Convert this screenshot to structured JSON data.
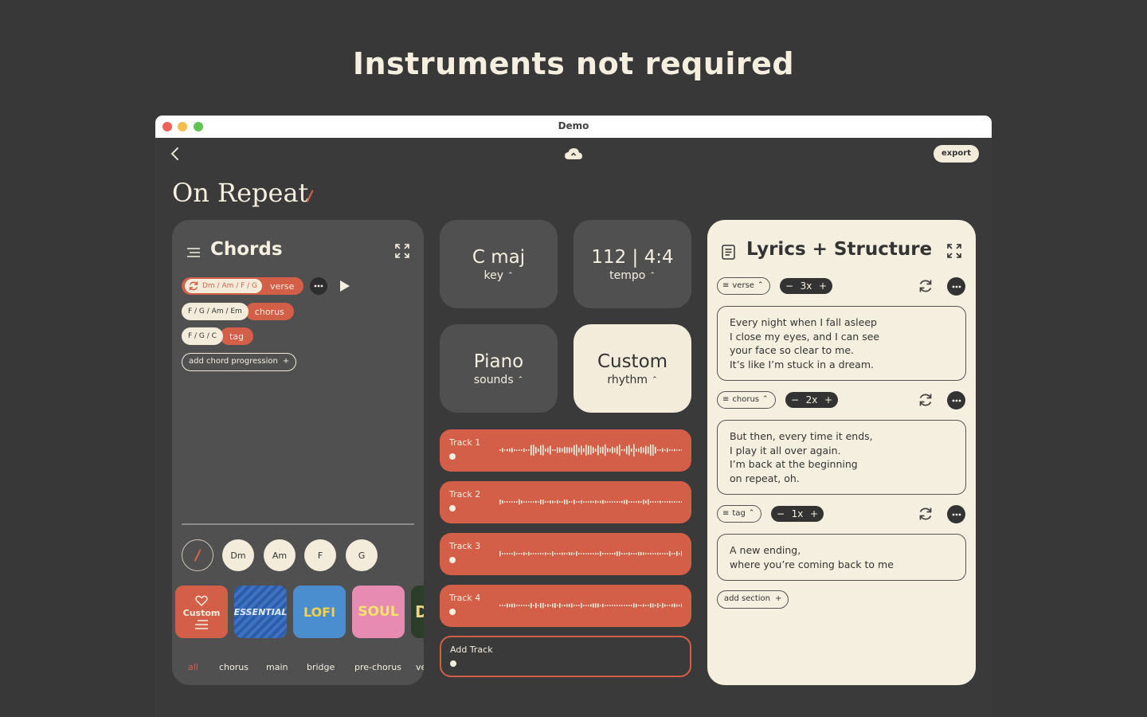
{
  "hero": {
    "headline": "Instruments not required"
  },
  "window": {
    "title": "Demo",
    "export_label": "export"
  },
  "song": {
    "title": "On Repeat"
  },
  "chords_panel": {
    "title": "Chords",
    "progressions": [
      {
        "chords": "Dm / Am / F / G",
        "section": "verse"
      },
      {
        "chords": "F / G / Am / Em",
        "section": "chorus"
      },
      {
        "chords": "F / G / C",
        "section": "tag"
      }
    ],
    "add_progression_label": "add chord progression",
    "plus": "+",
    "chord_buttons": [
      "Dm",
      "Am",
      "F",
      "G"
    ],
    "packs": [
      {
        "label": "Custom"
      },
      {
        "label": "ESSENTIAL"
      },
      {
        "label": "LOFI"
      },
      {
        "label": "SOUL"
      },
      {
        "label": "D"
      }
    ],
    "filters": [
      "all",
      "chorus",
      "main",
      "bridge",
      "pre-chorus",
      "ve"
    ],
    "active_filter": "all"
  },
  "settings": {
    "key": {
      "value": "C maj",
      "label": "key"
    },
    "tempo": {
      "value": "112 | 4:4",
      "label": "tempo"
    },
    "sounds": {
      "value": "Piano",
      "label": "sounds"
    },
    "rhythm": {
      "value": "Custom",
      "label": "rhythm"
    },
    "caret": "⌃"
  },
  "tracks": [
    {
      "name": "Track 1"
    },
    {
      "name": "Track 2"
    },
    {
      "name": "Track 3"
    },
    {
      "name": "Track 4"
    }
  ],
  "add_track_label": "Add Track",
  "lyrics_panel": {
    "title": "Lyrics + Structure",
    "sections": [
      {
        "name": "verse",
        "repeat": "3x",
        "lines": [
          "Every night when I fall asleep",
          "I close my eyes, and I can see",
          "your face so clear to me.",
          "It’s like I’m stuck in a dream."
        ]
      },
      {
        "name": "chorus",
        "repeat": "2x",
        "lines": [
          "But then, every time it ends,",
          "I play it all over again.",
          "I’m back at the beginning",
          "on repeat, oh."
        ]
      },
      {
        "name": "tag",
        "repeat": "1x",
        "lines": [
          "A new ending,",
          "where you’re coming back to me"
        ]
      }
    ],
    "minus": "−",
    "plus": "+",
    "add_section_label": "add section"
  },
  "colors": {
    "accent": "#d45f48",
    "cream": "#f3ecdb",
    "panel": "#505050",
    "background": "#383838"
  }
}
